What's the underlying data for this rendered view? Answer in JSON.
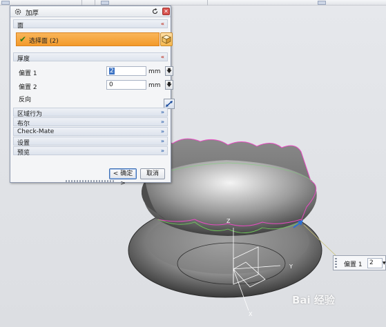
{
  "dialog": {
    "title": "加厚",
    "sections": {
      "face": {
        "label": "面",
        "select_label": "选择面 (2)"
      },
      "thickness": {
        "label": "厚度"
      },
      "offset1": {
        "label": "偏置 1",
        "value": "2",
        "unit": "mm"
      },
      "offset2": {
        "label": "偏置 2",
        "value": "0",
        "unit": "mm"
      },
      "reverse": {
        "label": "反向"
      },
      "collapsed": [
        "区域行为",
        "布尔",
        "Check-Mate",
        "设置",
        "预览"
      ]
    },
    "buttons": {
      "ok": "< 确定 >",
      "cancel": "取消"
    }
  },
  "floating_input": {
    "label": "偏置 1",
    "value": "2"
  },
  "axes": {
    "x": "X",
    "y": "Y",
    "z": "Z"
  },
  "watermark": "Bai 经验",
  "colors": {
    "accent": "#f39a2a",
    "close": "#d9534f",
    "selection_edge": "#e84cc2"
  }
}
